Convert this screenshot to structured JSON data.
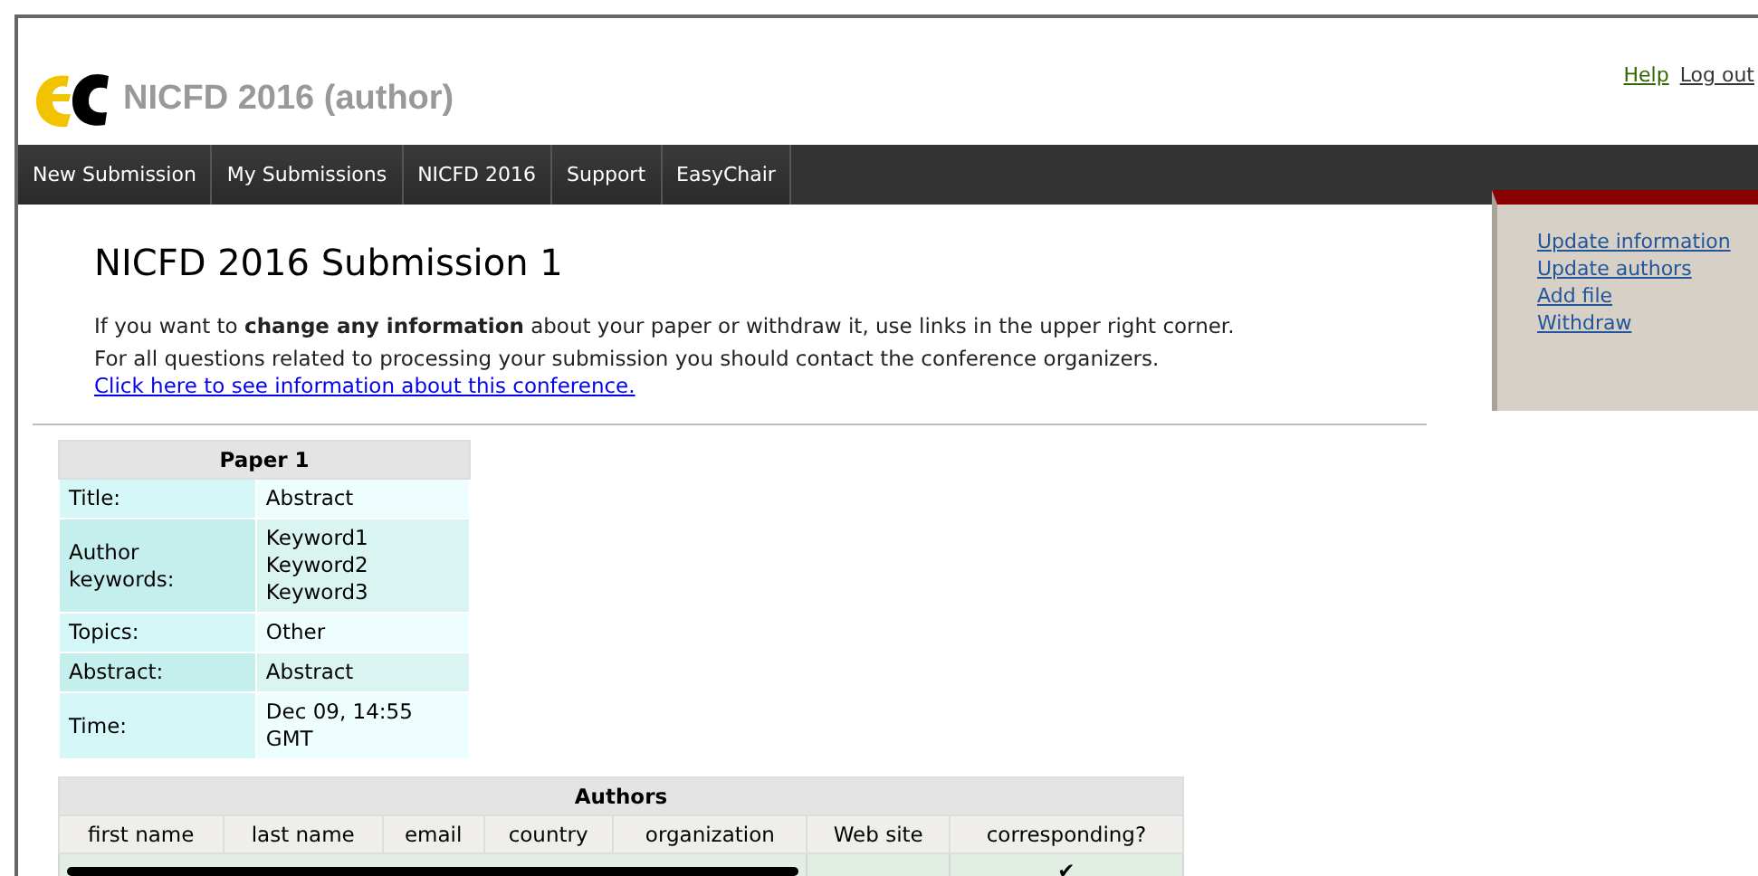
{
  "header": {
    "title": "NICFD 2016 (author)",
    "links": [
      "Help",
      "Log out"
    ]
  },
  "nav": [
    {
      "label": "New Submission"
    },
    {
      "label": "My Submissions"
    },
    {
      "label": "NICFD 2016"
    },
    {
      "label": "Support"
    },
    {
      "label": "EasyChair"
    }
  ],
  "sidebar": {
    "links": [
      "Update information",
      "Update authors",
      "Add file",
      "Withdraw"
    ]
  },
  "heading": "NICFD 2016 Submission 1",
  "paragraphs": [
    {
      "text": "If you want to **change any information** about your paper or withdraw it, use links in the upper right corner."
    },
    {
      "text": "For all questions related to processing your submission you should contact the conference organizers.",
      "link": "Click here to see information about this conference."
    }
  ],
  "paper_table": {
    "title": "Paper 1",
    "rows": [
      {
        "label": "Title:",
        "values": [
          "Abstract"
        ]
      },
      {
        "label": "Author keywords:",
        "values": [
          "Keyword1",
          "Keyword2",
          "Keyword3"
        ]
      },
      {
        "label": "Topics:",
        "values": [
          "Other"
        ]
      },
      {
        "label": "Abstract:",
        "values": [
          "Abstract"
        ]
      },
      {
        "label": "Time:",
        "values": [
          "Dec 09, 14:55 GMT"
        ]
      }
    ]
  },
  "authors_table": {
    "title": "Authors",
    "columns": [
      "first name",
      "last name",
      "email",
      "country",
      "organization",
      "Web site",
      "corresponding?"
    ],
    "rows": [
      {
        "redacted": true,
        "corresponding": "✔"
      }
    ]
  }
}
